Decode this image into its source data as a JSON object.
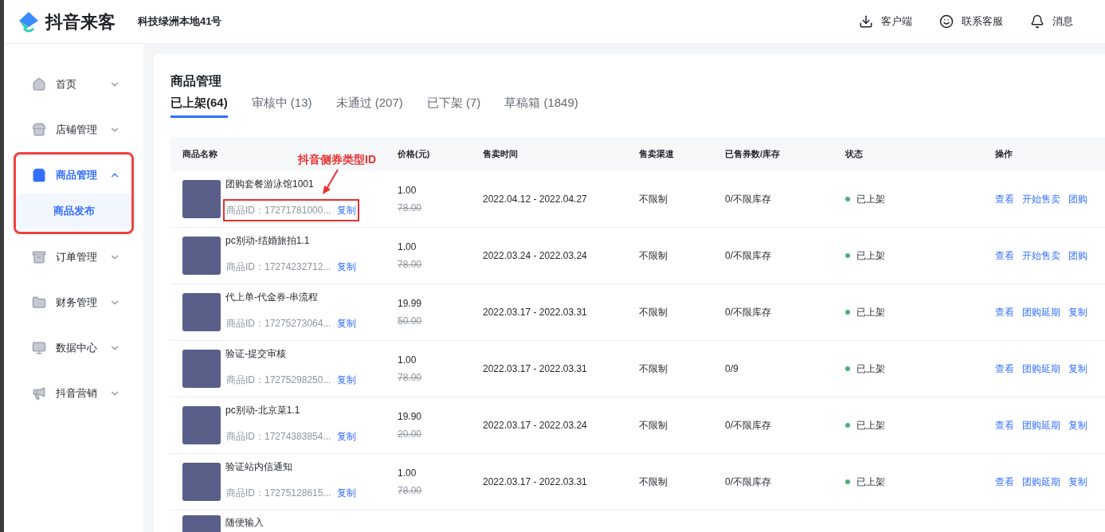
{
  "header": {
    "logo": "抖音来客",
    "store": "科技绿洲本地41号",
    "actions": [
      {
        "kind": "download",
        "label": "客户端"
      },
      {
        "kind": "service",
        "label": "联系客服"
      },
      {
        "kind": "bell",
        "label": "消息"
      }
    ]
  },
  "sidebar": {
    "items": [
      {
        "kind": "home",
        "label": "首页",
        "expanded": false,
        "highlighted": false
      },
      {
        "kind": "store",
        "label": "店铺管理",
        "expanded": false,
        "highlighted": false
      },
      {
        "kind": "bag",
        "label": "商品管理",
        "expanded": true,
        "highlighted": true,
        "children": [
          {
            "label": "商品发布",
            "selected": true
          }
        ]
      },
      {
        "kind": "order",
        "label": "订单管理",
        "expanded": false,
        "highlighted": false
      },
      {
        "kind": "folder",
        "label": "财务管理",
        "expanded": false,
        "highlighted": false
      },
      {
        "kind": "screen",
        "label": "数据中心",
        "expanded": false,
        "highlighted": false
      },
      {
        "kind": "megaphone",
        "label": "抖音营销",
        "expanded": false,
        "highlighted": false
      }
    ]
  },
  "page": {
    "title": "商品管理",
    "tabs": [
      {
        "label": "已上架(64)",
        "selected": true
      },
      {
        "label": "审核中 (13)",
        "selected": false
      },
      {
        "label": "未通过 (207)",
        "selected": false
      },
      {
        "label": "已下架 (7)",
        "selected": false
      },
      {
        "label": "草稿箱 (1849)",
        "selected": false
      }
    ]
  },
  "annotation": {
    "label": "抖音侧券类型ID"
  },
  "table": {
    "columns": [
      "商品名称",
      "价格(元)",
      "售卖时间",
      "售卖渠道",
      "已售券数/库存",
      "状态",
      "操作"
    ],
    "rows": [
      {
        "name": "团购套餐游泳馆1001",
        "id": "商品ID：17271781000...",
        "copy": "复制",
        "annotated": true,
        "price": "1.00",
        "original_price": "78.00",
        "time": "2022.04.12 - 2022.04.27",
        "channel": "不限制",
        "stock": "0/不限库存",
        "status": "已上架",
        "actions": [
          "查看",
          "开始售卖",
          "团购"
        ]
      },
      {
        "name": "pc别动-结婚旅拍1.1",
        "id": "商品ID：17274232712...",
        "copy": "复制",
        "annotated": false,
        "price": "1.00",
        "original_price": "78.00",
        "time": "2022.03.24 - 2022.03.24",
        "channel": "不限制",
        "stock": "0/不限库存",
        "status": "已上架",
        "actions": [
          "查看",
          "开始售卖",
          "团购"
        ]
      },
      {
        "name": "代上单-代金券-串流程",
        "id": "商品ID：17275273064...",
        "copy": "复制",
        "annotated": false,
        "price": "19.99",
        "original_price": "50.00",
        "time": "2022.03.17 - 2022.03.31",
        "channel": "不限制",
        "stock": "0/不限库存",
        "status": "已上架",
        "actions": [
          "查看",
          "团购延期",
          "复制"
        ]
      },
      {
        "name": "验证-提交审核",
        "id": "商品ID：17275298250...",
        "copy": "复制",
        "annotated": false,
        "price": "1.00",
        "original_price": "78.00",
        "time": "2022.03.17 - 2022.03.31",
        "channel": "不限制",
        "stock": "0/9",
        "status": "已上架",
        "actions": [
          "查看",
          "团购延期",
          "复制"
        ]
      },
      {
        "name": "pc别动-北京菜1.1",
        "id": "商品ID：17274383854...",
        "copy": "复制",
        "annotated": false,
        "price": "19.90",
        "original_price": "20.00",
        "time": "2022.03.17 - 2022.03.24",
        "channel": "不限制",
        "stock": "0/不限库存",
        "status": "已上架",
        "actions": [
          "查看",
          "团购延期",
          "复制"
        ]
      },
      {
        "name": "验证站内信通知",
        "id": "商品ID：17275128615...",
        "copy": "复制",
        "annotated": false,
        "price": "1.00",
        "original_price": "78.00",
        "time": "2022.03.17 - 2022.03.31",
        "channel": "不限制",
        "stock": "0/不限库存",
        "status": "已上架",
        "actions": [
          "查看",
          "团购延期",
          "复制"
        ]
      },
      {
        "name": "随便输入"
      }
    ]
  }
}
